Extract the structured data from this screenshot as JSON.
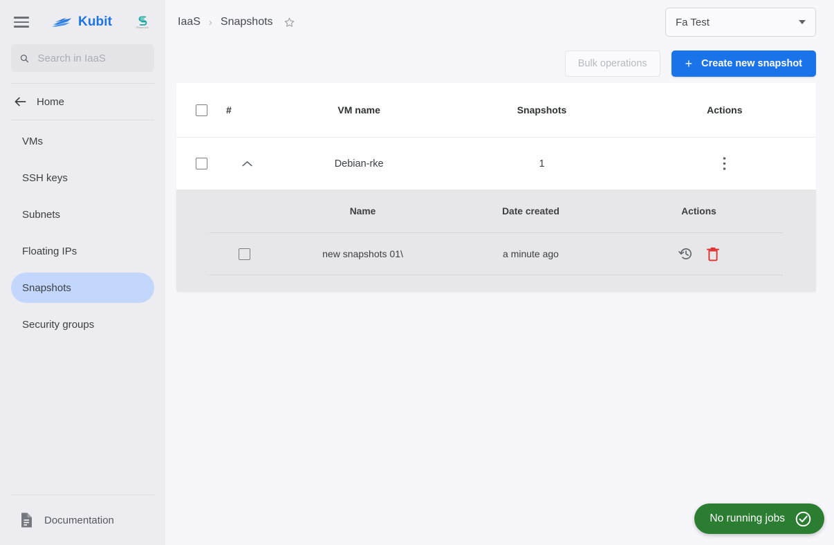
{
  "brand": {
    "name": "Kubit",
    "logo_icon": "wave-boat-icon",
    "partner_logo_icon": "partner-s-icon",
    "partner_sub_text": "Please join"
  },
  "sidebar": {
    "menu_icon": "hamburger-menu-icon",
    "search": {
      "icon": "search-icon",
      "placeholder": "Search in IaaS",
      "value": ""
    },
    "home": {
      "icon": "arrow-left-icon",
      "label": "Home"
    },
    "items": [
      {
        "label": "VMs",
        "active": false
      },
      {
        "label": "SSH keys",
        "active": false
      },
      {
        "label": "Subnets",
        "active": false
      },
      {
        "label": "Floating IPs",
        "active": false
      },
      {
        "label": "Snapshots",
        "active": true
      },
      {
        "label": "Security groups",
        "active": false
      }
    ],
    "footer": {
      "icon": "document-icon",
      "label": "Documentation"
    }
  },
  "header": {
    "breadcrumb": [
      "IaaS",
      "Snapshots"
    ],
    "separator": "›",
    "favorite_icon": "star-outline-icon",
    "project_select": {
      "value": "Fa Test",
      "caret_icon": "chevron-down-icon"
    }
  },
  "toolbar": {
    "bulk_label": "Bulk operations",
    "bulk_disabled": true,
    "create_label": "Create new snapshot",
    "create_icon": "plus-icon"
  },
  "table": {
    "columns": [
      "#",
      "VM name",
      "Snapshots",
      "Actions"
    ],
    "select_all_checkbox": "checkbox-icon",
    "rows": [
      {
        "checkbox": "checkbox-icon",
        "expand_icon": "chevron-up-icon",
        "vm_name": "Debian-rke",
        "snapshots": "1",
        "actions_icon": "more-vertical-icon",
        "expanded": true,
        "sub_table": {
          "columns": [
            "Name",
            "Date created",
            "Actions"
          ],
          "rows": [
            {
              "checkbox": "checkbox-icon",
              "name": "new snapshots 01\\",
              "date_created": "a minute ago",
              "restore_icon": "restore-history-icon",
              "delete_icon": "trash-delete-icon"
            }
          ]
        }
      }
    ]
  },
  "toast": {
    "label": "No running jobs",
    "icon": "check-circle-icon"
  },
  "colors": {
    "accent": "#1a73e8",
    "active_nav": "#c2d7fb",
    "toast_green": "#2b7d32",
    "delete_red": "#e03131",
    "sidebar_bg": "#ededf1",
    "content_bg": "#f7f7fb",
    "subpanel_bg": "#e7e7ea"
  }
}
